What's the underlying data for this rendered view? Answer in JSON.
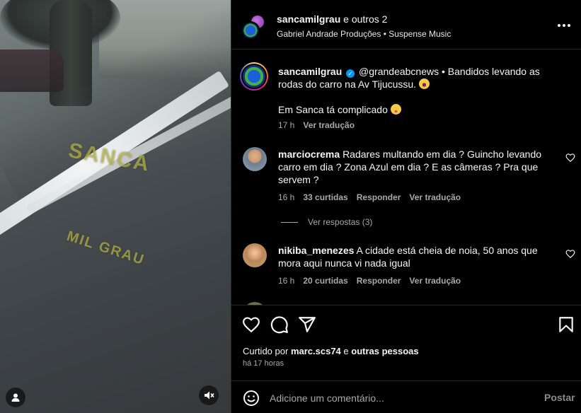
{
  "video": {
    "watermark_top": "SANCA",
    "watermark_bottom": "MIL GRAU"
  },
  "header": {
    "author": "sancamilgrau",
    "coauthors": "e outros 2",
    "audio": "Gabriel Andrade Produções • Suspense Music"
  },
  "caption": {
    "username": "sancamilgrau",
    "text_part1": "@grandeabcnews • Bandidos levando as rodas do carro na Av Tijucussu.",
    "text_part2": "Em Sanca tá complicado",
    "time": "17 h",
    "translate": "Ver tradução"
  },
  "comments": [
    {
      "username": "marciocrema",
      "text": "Radares multando em dia ? Guincho levando carro em dia ? Zona Azul em dia ? E as câmeras ? Pra que servem ?",
      "time": "16 h",
      "likes": "33 curtidas",
      "reply": "Responder",
      "translate": "Ver tradução",
      "view_replies": "Ver respostas (3)"
    },
    {
      "username": "nikiba_menezes",
      "text": "A cidade está cheia de noia, 50 anos que mora aqui nunca vi nada igual",
      "time": "16 h",
      "likes": "20 curtidas",
      "reply": "Responder",
      "translate": "Ver tradução"
    }
  ],
  "likes": {
    "prefix": "Curtido por",
    "user": "marc.scs74",
    "joiner": "e",
    "others": "outras pessoas"
  },
  "posted_ago": "há 17 horas",
  "composer": {
    "placeholder": "Adicione um comentário...",
    "post_label": "Postar"
  },
  "colors": {
    "background": "#000000",
    "secondary_text": "#a8a8a8",
    "verified_blue": "#0095f6",
    "watermark": "#dcd75a"
  },
  "icons": [
    "user-icon",
    "muted-speaker-icon",
    "more-options-icon",
    "verified-badge-icon",
    "heart-icon",
    "comment-icon",
    "share-icon",
    "bookmark-icon",
    "emoji-icon"
  ]
}
